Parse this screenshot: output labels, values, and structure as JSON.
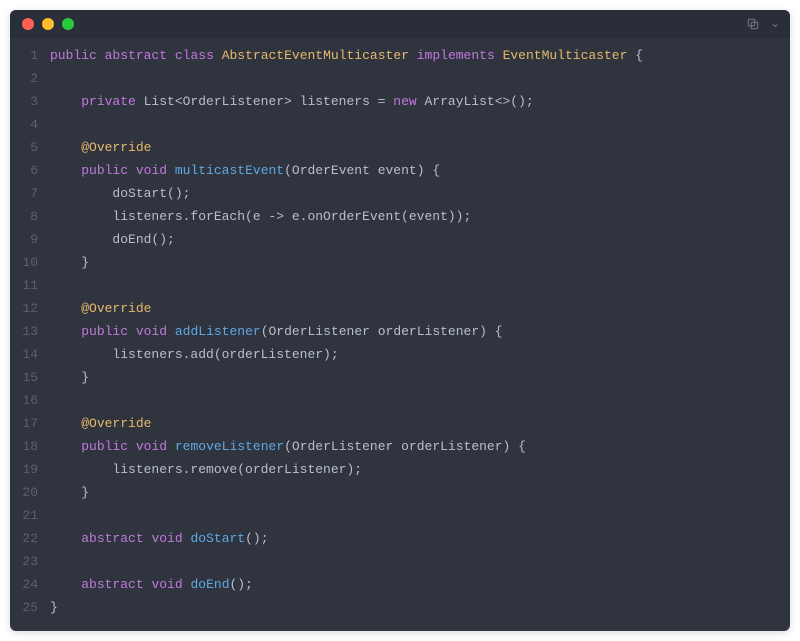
{
  "titlebar": {
    "copy_label": "copy",
    "chevron_label": "expand"
  },
  "lines": [
    [
      [
        "k",
        "public"
      ],
      [
        "p",
        " "
      ],
      [
        "k",
        "abstract"
      ],
      [
        "p",
        " "
      ],
      [
        "k",
        "class"
      ],
      [
        "p",
        " "
      ],
      [
        "cls",
        "AbstractEventMulticaster"
      ],
      [
        "p",
        " "
      ],
      [
        "k",
        "implements"
      ],
      [
        "p",
        " "
      ],
      [
        "cls",
        "EventMulticaster"
      ],
      [
        "p",
        " {"
      ]
    ],
    [
      [
        "p",
        ""
      ]
    ],
    [
      [
        "p",
        "    "
      ],
      [
        "k",
        "private"
      ],
      [
        "p",
        " List<OrderListener> listeners = "
      ],
      [
        "k",
        "new"
      ],
      [
        "p",
        " ArrayList<>();"
      ]
    ],
    [
      [
        "p",
        ""
      ]
    ],
    [
      [
        "p",
        "    "
      ],
      [
        "an",
        "@Override"
      ]
    ],
    [
      [
        "p",
        "    "
      ],
      [
        "k",
        "public"
      ],
      [
        "p",
        " "
      ],
      [
        "k",
        "void"
      ],
      [
        "p",
        " "
      ],
      [
        "fn",
        "multicastEvent"
      ],
      [
        "p",
        "(OrderEvent event) {"
      ]
    ],
    [
      [
        "p",
        "        doStart();"
      ]
    ],
    [
      [
        "p",
        "        listeners.forEach(e -> e.onOrderEvent(event));"
      ]
    ],
    [
      [
        "p",
        "        doEnd();"
      ]
    ],
    [
      [
        "p",
        "    }"
      ]
    ],
    [
      [
        "p",
        ""
      ]
    ],
    [
      [
        "p",
        "    "
      ],
      [
        "an",
        "@Override"
      ]
    ],
    [
      [
        "p",
        "    "
      ],
      [
        "k",
        "public"
      ],
      [
        "p",
        " "
      ],
      [
        "k",
        "void"
      ],
      [
        "p",
        " "
      ],
      [
        "fn",
        "addListener"
      ],
      [
        "p",
        "(OrderListener orderListener) {"
      ]
    ],
    [
      [
        "p",
        "        listeners.add(orderListener);"
      ]
    ],
    [
      [
        "p",
        "    }"
      ]
    ],
    [
      [
        "p",
        ""
      ]
    ],
    [
      [
        "p",
        "    "
      ],
      [
        "an",
        "@Override"
      ]
    ],
    [
      [
        "p",
        "    "
      ],
      [
        "k",
        "public"
      ],
      [
        "p",
        " "
      ],
      [
        "k",
        "void"
      ],
      [
        "p",
        " "
      ],
      [
        "fn",
        "removeListener"
      ],
      [
        "p",
        "(OrderListener orderListener) {"
      ]
    ],
    [
      [
        "p",
        "        listeners.remove(orderListener);"
      ]
    ],
    [
      [
        "p",
        "    }"
      ]
    ],
    [
      [
        "p",
        ""
      ]
    ],
    [
      [
        "p",
        "    "
      ],
      [
        "k",
        "abstract"
      ],
      [
        "p",
        " "
      ],
      [
        "k",
        "void"
      ],
      [
        "p",
        " "
      ],
      [
        "fn",
        "doStart"
      ],
      [
        "p",
        "();"
      ]
    ],
    [
      [
        "p",
        ""
      ]
    ],
    [
      [
        "p",
        "    "
      ],
      [
        "k",
        "abstract"
      ],
      [
        "p",
        " "
      ],
      [
        "k",
        "void"
      ],
      [
        "p",
        " "
      ],
      [
        "fn",
        "doEnd"
      ],
      [
        "p",
        "();"
      ]
    ],
    [
      [
        "p",
        "}"
      ]
    ]
  ]
}
